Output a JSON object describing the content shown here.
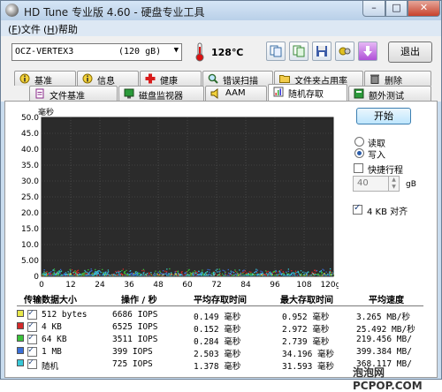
{
  "window": {
    "title": "HD Tune 专业版 4.60 - 硬盘专业工具",
    "minimize": "–",
    "maximize": "□",
    "close": "✕"
  },
  "menu": {
    "file": "文件",
    "file_key": "F",
    "help": "帮助",
    "help_key": "H"
  },
  "toolbar": {
    "drive_name": "OCZ-VERTEX3",
    "drive_size": "(120 gB)",
    "temperature": "128℃",
    "exit_label": "退出"
  },
  "tabs_row1": [
    {
      "label": "基准",
      "icon": "info-icon"
    },
    {
      "label": "信息",
      "icon": "info-card-icon"
    },
    {
      "label": "健康",
      "icon": "health-cross-icon"
    },
    {
      "label": "错误扫描",
      "icon": "magnifier-icon"
    },
    {
      "label": "文件夹占用率",
      "icon": "folder-icon"
    },
    {
      "label": "删除",
      "icon": "trash-icon"
    }
  ],
  "tabs_row2": [
    {
      "label": "文件基准",
      "icon": "file-icon"
    },
    {
      "label": "磁盘监视器",
      "icon": "monitor-icon"
    },
    {
      "label": "AAM",
      "icon": "speaker-icon"
    },
    {
      "label": "随机存取",
      "icon": "random-access-icon"
    },
    {
      "label": "额外测试",
      "icon": "extra-test-icon"
    }
  ],
  "controls": {
    "start_label": "开始",
    "read_label": "读取",
    "write_label": "写入",
    "mode_selected": "write",
    "quick_label": "快捷行程",
    "quick_value": "40",
    "quick_unit": "gB",
    "align_label": "4 KB 对齐",
    "align_checked": true
  },
  "chart_data": {
    "type": "scatter",
    "ylabel": "毫秒",
    "xlabel": "",
    "x_ticks": [
      "0",
      "12",
      "24",
      "36",
      "48",
      "60",
      "72",
      "84",
      "96",
      "108",
      "120gB"
    ],
    "y_ticks": [
      "0",
      "5.00",
      "10.0",
      "15.0",
      "20.0",
      "25.0",
      "30.0",
      "35.0",
      "40.0",
      "45.0",
      "50.0"
    ],
    "xlim": [
      0,
      120
    ],
    "ylim": [
      0,
      50
    ],
    "grid": true,
    "background": "#2b2b2b",
    "series": [
      {
        "name": "512 bytes",
        "color": "#e8e84a",
        "max_ms": 0.952
      },
      {
        "name": "4 KB",
        "color": "#d42a2a",
        "max_ms": 2.972
      },
      {
        "name": "64 KB",
        "color": "#3bc23b",
        "max_ms": 2.739
      },
      {
        "name": "1 MB",
        "color": "#3a6fd8",
        "max_ms": 34.196
      },
      {
        "name": "随机",
        "color": "#38c8d8",
        "max_ms": 31.593
      }
    ]
  },
  "results": {
    "headers": {
      "size": "传输数据大小",
      "ops": "操作 / 秒",
      "avg": "平均存取时间",
      "max": "最大存取时间",
      "speed": "平均速度"
    },
    "rows": [
      {
        "size": "512 bytes",
        "ops": "6686 IOPS",
        "avg": "0.149 毫秒",
        "max": "0.952 毫秒",
        "speed": "3.265 MB/秒",
        "color": "#e8e84a"
      },
      {
        "size": "4 KB",
        "ops": "6525 IOPS",
        "avg": "0.152 毫秒",
        "max": "2.972 毫秒",
        "speed": "25.492 MB/秒",
        "color": "#d42a2a"
      },
      {
        "size": "64 KB",
        "ops": "3511 IOPS",
        "avg": "0.284 毫秒",
        "max": "2.739 毫秒",
        "speed": "219.456 MB/",
        "color": "#3bc23b"
      },
      {
        "size": "1 MB",
        "ops": "399 IOPS",
        "avg": "2.503 毫秒",
        "max": "34.196 毫秒",
        "speed": "399.384 MB/",
        "color": "#3a6fd8"
      },
      {
        "size": "随机",
        "ops": "725 IOPS",
        "avg": "1.378 毫秒",
        "max": "31.593 毫秒",
        "speed": "368.117 MB/",
        "color": "#38c8d8"
      }
    ]
  },
  "watermark": "泡泡网 PCPOP.COM"
}
